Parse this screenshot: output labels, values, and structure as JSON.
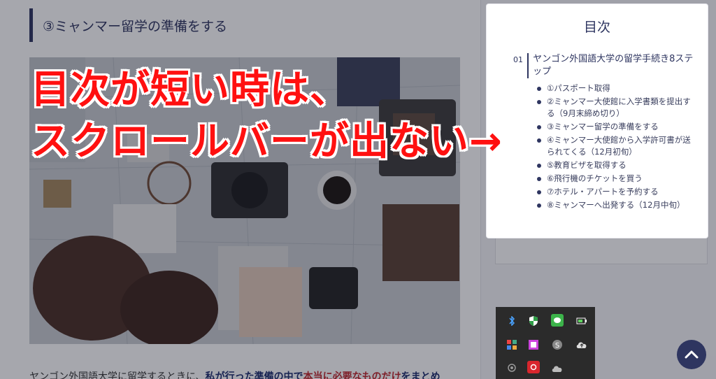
{
  "article": {
    "heading": "③ミャンマー留学の準備をする",
    "body_pre": "ヤンゴン外国語大学に留学するときに、",
    "body_bold": "私が行った準備の中で",
    "body_red": "本当に必要なものだけ",
    "body_bold2": "をまとめ"
  },
  "annotation": {
    "line1": "目次が短い時は、",
    "line2": "スクロールバーが出ない→",
    "color": "#ff1010"
  },
  "toc": {
    "title": "目次",
    "h2_number": "01",
    "h2_label": "ヤンゴン外国語大学の留学手続き8ステップ",
    "items": [
      "①パスポート取得",
      "②ミャンマー大使館に入学書類を提出する（9月末締め切り）",
      "③ミャンマー留学の準備をする",
      "④ミャンマー大使館から入学許可書が送られてくる（12月初旬）",
      "⑤教育ビザを取得する",
      "⑥飛行機のチケットを買う",
      "⑦ホテル・アパートを予約する",
      "⑧ミャンマーへ出発する（12月中旬）"
    ]
  },
  "tray": {
    "icons": [
      "bluetooth-icon",
      "security-shield-icon",
      "chat-icon",
      "battery-icon",
      "apps-icon",
      "image-icon",
      "skype-icon",
      "cloud-upload-icon",
      "webcam-icon",
      "photo-app-icon",
      "cloud-sync-icon"
    ]
  },
  "colors": {
    "accent": "#2e3560",
    "annotation_red": "#ff1010"
  }
}
